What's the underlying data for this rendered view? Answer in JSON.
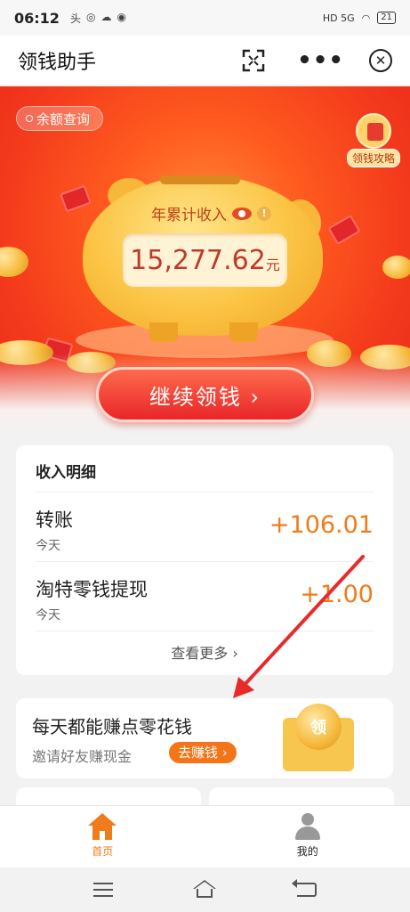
{
  "status_bar": {
    "time": "06:12",
    "notif_icons": [
      "头",
      "◎",
      "☁",
      "◉"
    ],
    "network": "HD 5G",
    "battery": "21"
  },
  "header": {
    "title": "领钱助手",
    "more_icon": "•••",
    "close_icon": "✕"
  },
  "hero": {
    "balance_query": "余额查询",
    "strategy_label": "领钱攻略",
    "income_label": "年累计收入",
    "info_icon": "!",
    "amount": "15,277.62",
    "unit": "元",
    "continue_button": "继续领钱 ›"
  },
  "income": {
    "title": "收入明细",
    "rows": [
      {
        "name": "转账",
        "date": "今天",
        "amount": "+106.01"
      },
      {
        "name": "淘特零钱提现",
        "date": "今天",
        "amount": "+1.00"
      }
    ],
    "view_more": "查看更多 ›"
  },
  "promo": {
    "title": "每天都能赚点零花钱",
    "subtitle": "邀请好友赚现金",
    "earn_button": "去赚钱 ›",
    "coin_text": "领"
  },
  "tabbar": {
    "home": "首页",
    "me": "我的"
  },
  "colors": {
    "accent_orange": "#f07b1a",
    "hero_red": "#e8281a",
    "annotation_arrow": "#e82a2a"
  }
}
